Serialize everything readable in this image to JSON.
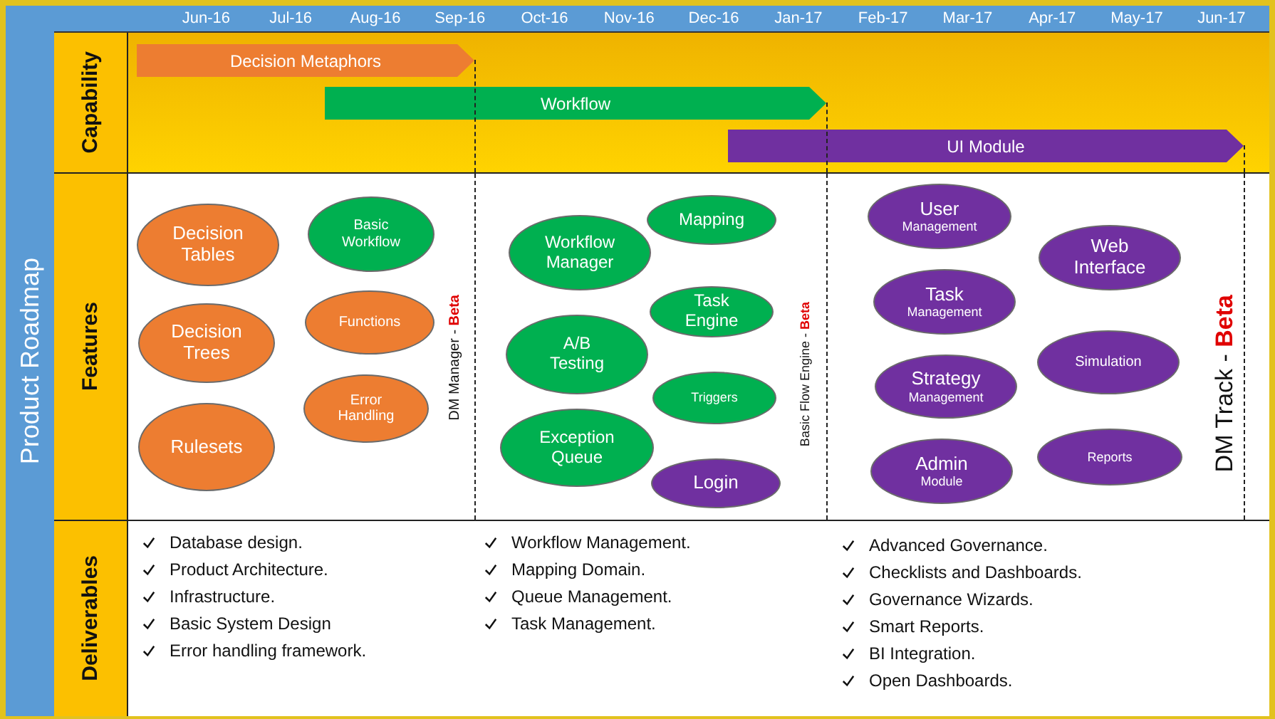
{
  "title": "Product Roadmap",
  "months": [
    "Jun-16",
    "Jul-16",
    "Aug-16",
    "Sep-16",
    "Oct-16",
    "Nov-16",
    "Dec-16",
    "Jan-17",
    "Feb-17",
    "Mar-17",
    "Apr-17",
    "May-17",
    "Jun-17"
  ],
  "capability": {
    "label": "Capability",
    "bars": [
      {
        "name": "Decision Metaphors",
        "color": "#ed7d31"
      },
      {
        "name": "Workflow",
        "color": "#00b050"
      },
      {
        "name": "UI Module",
        "color": "#7030a0"
      }
    ]
  },
  "features": {
    "label": "Features",
    "items": [
      {
        "title": "Decision Tables",
        "color": "#ed7d31"
      },
      {
        "title": "Decision Trees",
        "color": "#ed7d31"
      },
      {
        "title": "Rulesets",
        "color": "#ed7d31"
      },
      {
        "title": "Basic Workflow",
        "color": "#00b050"
      },
      {
        "title": "Functions",
        "color": "#ed7d31"
      },
      {
        "title": "Error Handling",
        "color": "#ed7d31"
      },
      {
        "title": "Workflow Manager",
        "color": "#00b050"
      },
      {
        "title": "Mapping",
        "color": "#00b050"
      },
      {
        "title": "A/B Testing",
        "color": "#00b050"
      },
      {
        "title": "Task Engine",
        "color": "#00b050"
      },
      {
        "title": "Triggers",
        "color": "#00b050"
      },
      {
        "title": "Exception Queue",
        "color": "#00b050"
      },
      {
        "title": "Login",
        "color": "#7030a0"
      },
      {
        "title": "User",
        "subtitle": "Management",
        "color": "#7030a0"
      },
      {
        "title": "Task",
        "subtitle": "Management",
        "color": "#7030a0"
      },
      {
        "title": "Strategy",
        "subtitle": "Management",
        "color": "#7030a0"
      },
      {
        "title": "Admin",
        "subtitle": "Module",
        "color": "#7030a0"
      },
      {
        "title": "Web Interface",
        "color": "#7030a0"
      },
      {
        "title": "Simulation",
        "color": "#7030a0"
      },
      {
        "title": "Reports",
        "color": "#7030a0"
      }
    ],
    "milestones": [
      "DM Manager - **Beta**",
      "Basic Flow Engine - **Beta**",
      "DM Track - **Beta**"
    ]
  },
  "deliverables": {
    "label": "Deliverables",
    "columns": [
      [
        "Database design.",
        "Product Architecture.",
        "Infrastructure.",
        "Basic System Design",
        "Error handling framework."
      ],
      [
        "Workflow Management.",
        "Mapping Domain.",
        "Queue Management.",
        "Task Management."
      ],
      [
        "Advanced Governance.",
        "Checklists and Dashboards.",
        "Governance Wizards.",
        "Smart Reports.",
        "BI Integration.",
        "Open Dashboards."
      ]
    ]
  }
}
